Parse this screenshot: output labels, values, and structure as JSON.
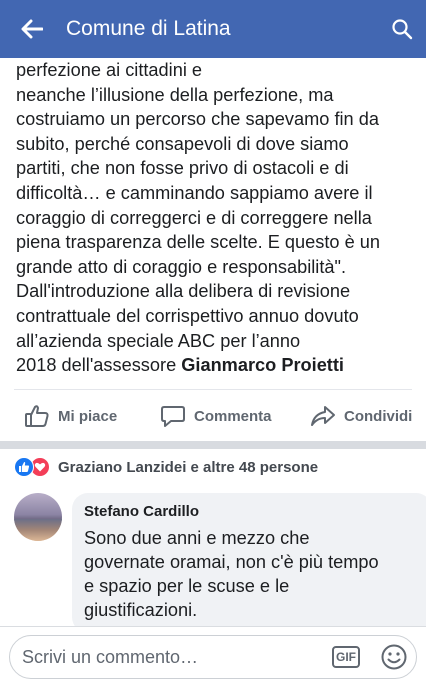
{
  "header": {
    "title": "Comune di Latina"
  },
  "post": {
    "lines": [
      "perfezione ai cittadini e",
      "neanche l’illusione della perfezione, ma",
      "costruiamo un percorso che sapevamo fin da",
      "subito, perché consapevoli di dove siamo",
      "partiti, che non fosse privo di ostacoli e di",
      "difficoltà… e camminando sappiamo avere il",
      "coraggio di correggerci e di correggere nella",
      "piena trasparenza delle scelte. E questo è un",
      "grande atto di coraggio e responsabilità\".",
      "Dall'introduzione alla delibera di revisione",
      "contrattuale del corrispettivo annuo dovuto",
      "all’azienda speciale ABC per l’anno"
    ],
    "last_line_prefix": "2018 dell'assessore ",
    "last_line_bold": "Gianmarco Proietti"
  },
  "actions": {
    "like": "Mi piace",
    "comment": "Commenta",
    "share": "Condividi"
  },
  "reactions": {
    "text": "Graziano Lanzidei e altre 48 persone",
    "icons": [
      "like-icon",
      "love-icon"
    ]
  },
  "comment": {
    "author": "Stefano Cardillo",
    "lines": [
      "Sono due anni e mezzo che",
      "governate oramai, non c'è più tempo",
      "e spazio per le scuse e le",
      "giustificazioni."
    ]
  },
  "composer": {
    "placeholder": "Scrivi un commento…",
    "gif_label": "GIF"
  },
  "colors": {
    "header_bg": "#4267b2",
    "like_blue": "#1877f2",
    "love_red": "#f33e58",
    "secondary_text": "#606770"
  }
}
